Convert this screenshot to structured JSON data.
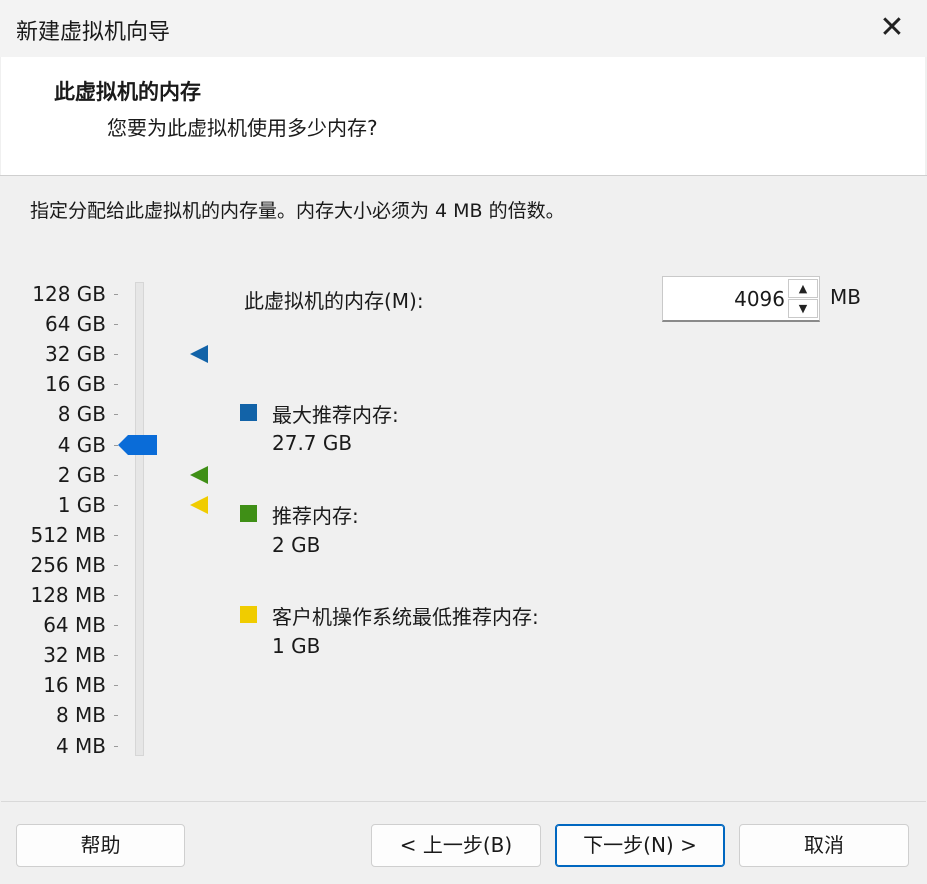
{
  "window": {
    "title": "新建虚拟机向导",
    "close_glyph": "✕"
  },
  "header": {
    "title": "此虚拟机的内存",
    "subtitle": "您要为此虚拟机使用多少内存?"
  },
  "instruction": "指定分配给此虚拟机的内存量。内存大小必须为 4 MB 的倍数。",
  "scale": {
    "labels": [
      "128 GB",
      "64 GB",
      "32 GB",
      "16 GB",
      "8 GB",
      "4 GB",
      "2 GB",
      "1 GB",
      "512 MB",
      "256 MB",
      "128 MB",
      "64 MB",
      "32 MB",
      "16 MB",
      "8 MB",
      "4 MB"
    ],
    "current_value": "4 GB",
    "markers": [
      {
        "name": "max-recommended",
        "value": "32 GB",
        "color": "#1263a8"
      },
      {
        "name": "recommended",
        "value": "2 GB",
        "color": "#3f8f16"
      },
      {
        "name": "guest-os-minimum",
        "value": "1 GB",
        "color": "#f0cc00"
      }
    ],
    "thumb_color": "#0a6cd8"
  },
  "memory": {
    "label": "此虚拟机的内存(M):",
    "value": "4096",
    "unit": "MB",
    "up_glyph": "▲",
    "down_glyph": "▼"
  },
  "legend": [
    {
      "title": "最大推荐内存:",
      "value": "27.7 GB",
      "color": "#1263a8"
    },
    {
      "title": "推荐内存:",
      "value": "2 GB",
      "color": "#3f8f16"
    },
    {
      "title": "客户机操作系统最低推荐内存:",
      "value": "1 GB",
      "color": "#f0cc00"
    }
  ],
  "buttons": {
    "help": "帮助",
    "back": "< 上一步(B)",
    "next": "下一步(N) >",
    "cancel": "取消"
  }
}
